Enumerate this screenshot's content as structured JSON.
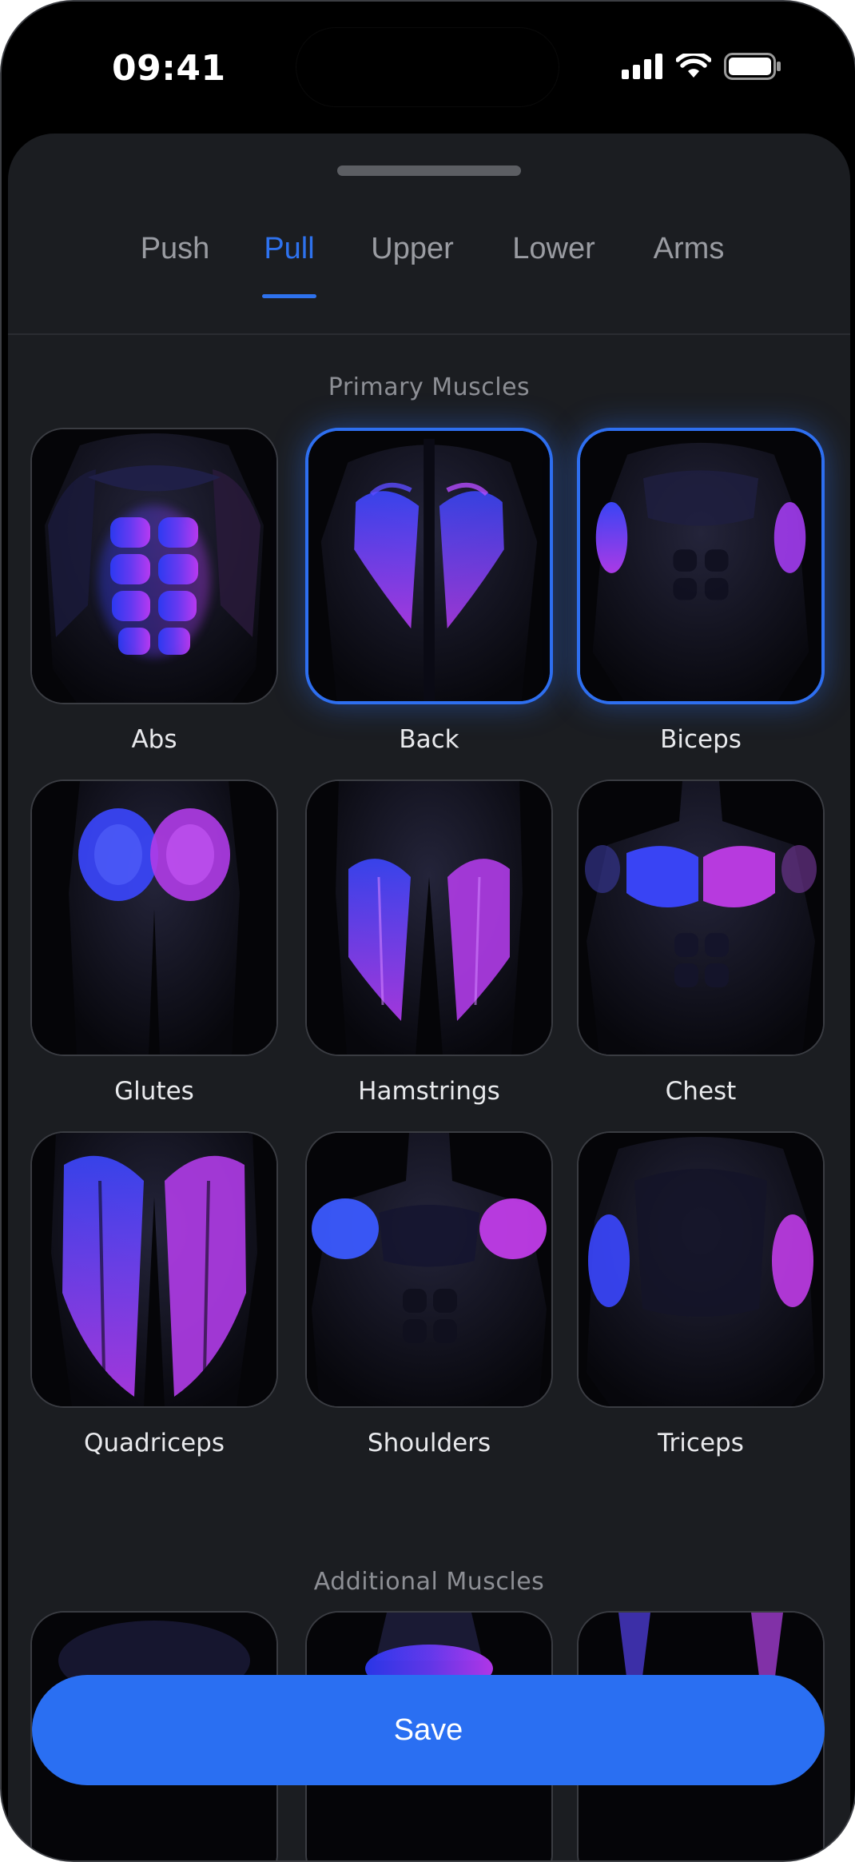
{
  "status_bar": {
    "time": "09:41"
  },
  "tabs": [
    {
      "label": "Push"
    },
    {
      "label": "Pull"
    },
    {
      "label": "Upper"
    },
    {
      "label": "Lower"
    },
    {
      "label": "Arms"
    }
  ],
  "active_tab": "Pull",
  "primary_section": {
    "title": "Primary Muscles",
    "muscles": [
      {
        "label": "Abs",
        "selected": false,
        "icon": "abs-muscle-image"
      },
      {
        "label": "Back",
        "selected": true,
        "icon": "back-muscle-image"
      },
      {
        "label": "Biceps",
        "selected": true,
        "icon": "biceps-muscle-image"
      },
      {
        "label": "Glutes",
        "selected": false,
        "icon": "glutes-muscle-image"
      },
      {
        "label": "Hamstrings",
        "selected": false,
        "icon": "hamstrings-muscle-image"
      },
      {
        "label": "Chest",
        "selected": false,
        "icon": "chest-muscle-image"
      },
      {
        "label": "Quadriceps",
        "selected": false,
        "icon": "quadriceps-muscle-image"
      },
      {
        "label": "Shoulders",
        "selected": false,
        "icon": "shoulders-muscle-image"
      },
      {
        "label": "Triceps",
        "selected": false,
        "icon": "triceps-muscle-image"
      }
    ]
  },
  "additional_section": {
    "title": "Additional Muscles"
  },
  "save_button": {
    "label": "Save"
  },
  "colors": {
    "accent": "#2e72ee",
    "glow_blue": "#3a4bff",
    "glow_purple": "#b43cff",
    "sheet_bg": "#1b1d21"
  }
}
